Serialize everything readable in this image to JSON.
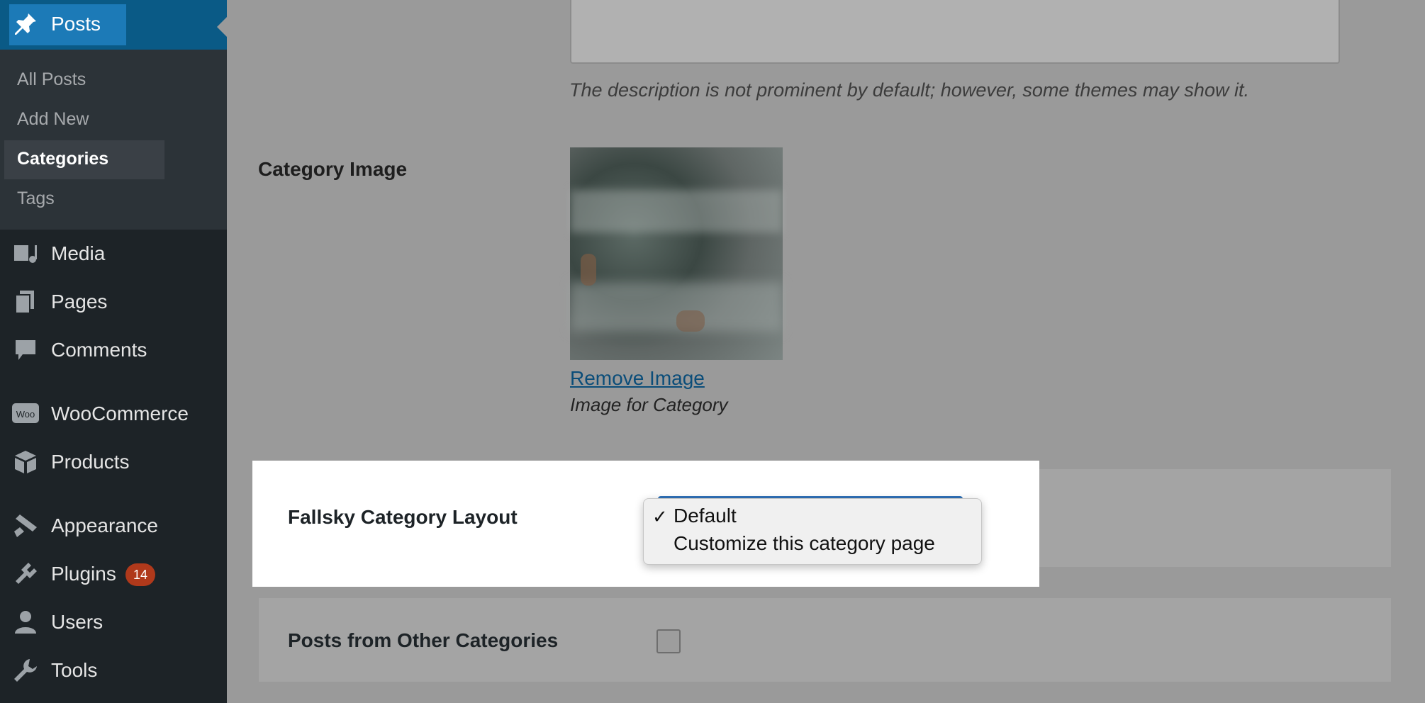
{
  "sidebar": {
    "posts_label": "Posts",
    "submenu": [
      {
        "label": "All Posts"
      },
      {
        "label": "Add New"
      },
      {
        "label": "Categories"
      },
      {
        "label": "Tags"
      }
    ],
    "items": [
      {
        "label": "Media",
        "icon": "media-icon"
      },
      {
        "label": "Pages",
        "icon": "pages-icon"
      },
      {
        "label": "Comments",
        "icon": "comments-icon"
      },
      {
        "label": "WooCommerce",
        "icon": "woocommerce-icon"
      },
      {
        "label": "Products",
        "icon": "products-icon"
      },
      {
        "label": "Appearance",
        "icon": "appearance-icon"
      },
      {
        "label": "Plugins",
        "icon": "plugins-icon",
        "badge": "14"
      },
      {
        "label": "Users",
        "icon": "users-icon"
      },
      {
        "label": "Tools",
        "icon": "tools-icon"
      }
    ]
  },
  "form": {
    "description_note": "The description is not prominent by default; however, some themes may show it.",
    "category_image_label": "Category Image",
    "remove_image": "Remove Image",
    "image_caption": "Image for Category",
    "layout_label": "Fallsky Category Layout",
    "layout_options": [
      "Default",
      "Customize this category page"
    ],
    "selected_option": "Default",
    "other_categories_label": "Posts from Other Categories"
  },
  "colors": {
    "sidebar_bg": "#1d2327",
    "active_blue": "#1c7ab7",
    "badge": "#b0391b",
    "link": "#0b4d79"
  }
}
